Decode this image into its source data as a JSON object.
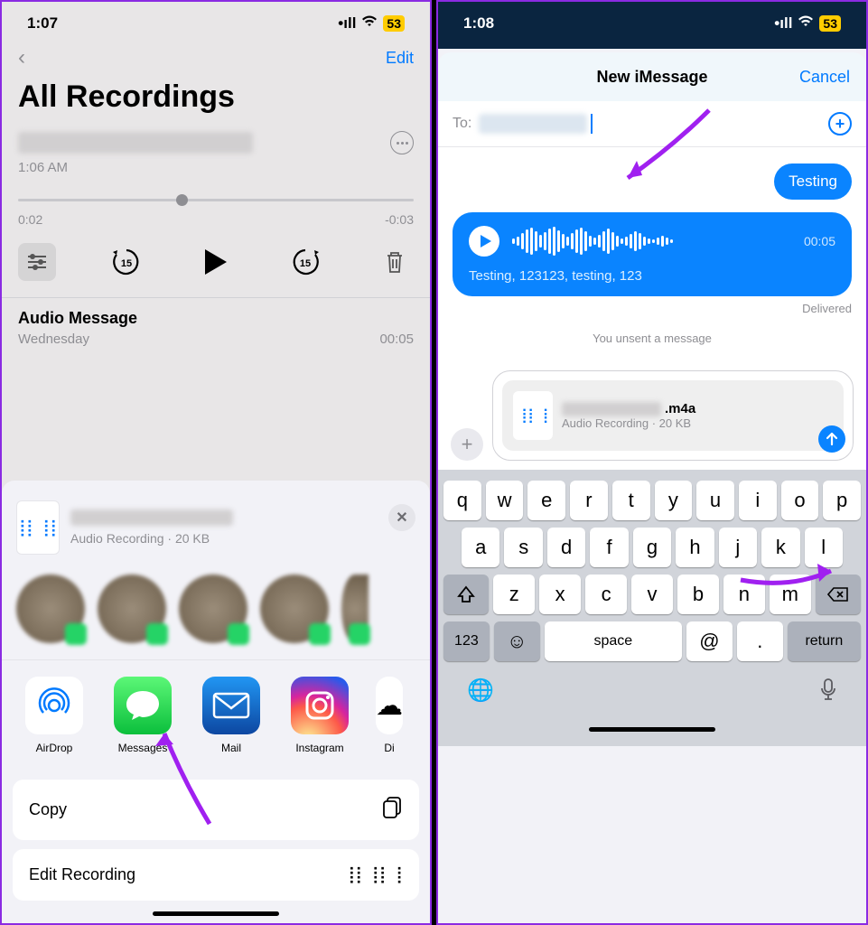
{
  "phone1": {
    "status": {
      "time": "1:07",
      "battery": "53"
    },
    "nav": {
      "edit": "Edit"
    },
    "title": "All Recordings",
    "current": {
      "time_label": "1:06 AM",
      "elapsed": "0:02",
      "remaining": "-0:03"
    },
    "item2": {
      "title": "Audio Message",
      "day": "Wednesday",
      "duration": "00:05"
    },
    "share": {
      "subtitle": "Audio Recording · 20 KB",
      "apps": {
        "airdrop": "AirDrop",
        "messages": "Messages",
        "mail": "Mail",
        "instagram": "Instagram",
        "last": "Di"
      },
      "copy": "Copy",
      "editrec": "Edit Recording"
    }
  },
  "phone2": {
    "status": {
      "time": "1:08",
      "battery": "53"
    },
    "sheet": {
      "title": "New iMessage",
      "cancel": "Cancel"
    },
    "to_label": "To:",
    "msg1": "Testing",
    "audio": {
      "duration": "00:05",
      "transcript": "Testing, 123123, testing, 123"
    },
    "delivered": "Delivered",
    "unsent": "You unsent a message",
    "attachment": {
      "ext": ".m4a",
      "sub": "Audio Recording · 20 KB"
    },
    "kb": {
      "r1": [
        "q",
        "w",
        "e",
        "r",
        "t",
        "y",
        "u",
        "i",
        "o",
        "p"
      ],
      "r2": [
        "a",
        "s",
        "d",
        "f",
        "g",
        "h",
        "j",
        "k",
        "l"
      ],
      "r3": [
        "z",
        "x",
        "c",
        "v",
        "b",
        "n",
        "m"
      ],
      "r4": {
        "num": "123",
        "space": "space",
        "at": "@",
        "dot": ".",
        "return": "return"
      }
    }
  }
}
